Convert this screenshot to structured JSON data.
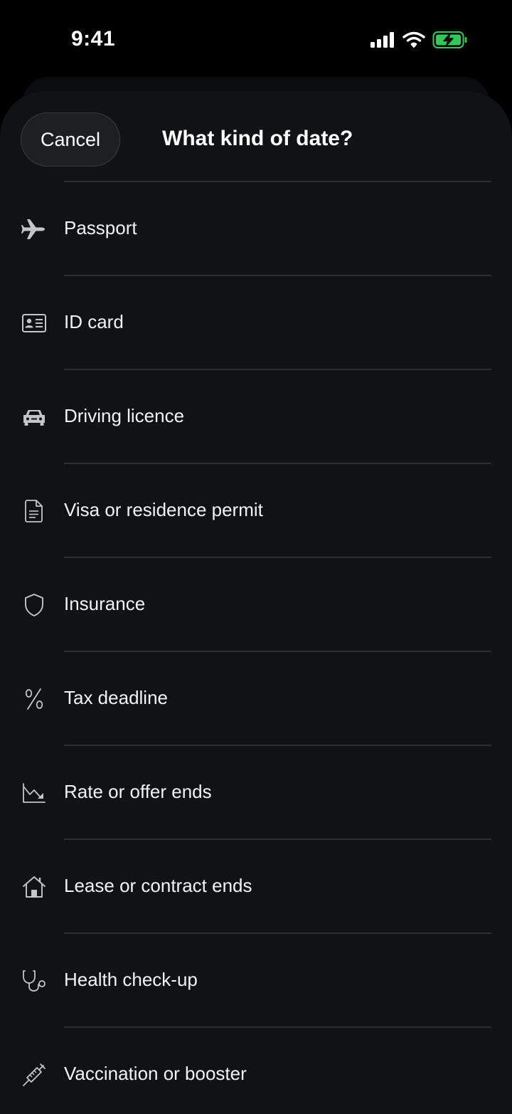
{
  "status_bar": {
    "time": "9:41"
  },
  "sheet": {
    "cancel_label": "Cancel",
    "title": "What kind of date?"
  },
  "colors": {
    "background": "#000000",
    "sheet": "#111216",
    "divider": "#2c2e33",
    "battery_green": "#34c759"
  },
  "options": [
    {
      "label": "Passport",
      "icon": "airplane-icon"
    },
    {
      "label": "ID card",
      "icon": "id-card-icon"
    },
    {
      "label": "Driving licence",
      "icon": "car-icon"
    },
    {
      "label": "Visa or residence permit",
      "icon": "document-icon"
    },
    {
      "label": "Insurance",
      "icon": "shield-icon"
    },
    {
      "label": "Tax deadline",
      "icon": "percent-icon"
    },
    {
      "label": "Rate or offer ends",
      "icon": "chart-down-icon"
    },
    {
      "label": "Lease or contract ends",
      "icon": "house-icon"
    },
    {
      "label": "Health check-up",
      "icon": "stethoscope-icon"
    },
    {
      "label": "Vaccination or booster",
      "icon": "syringe-icon"
    }
  ]
}
